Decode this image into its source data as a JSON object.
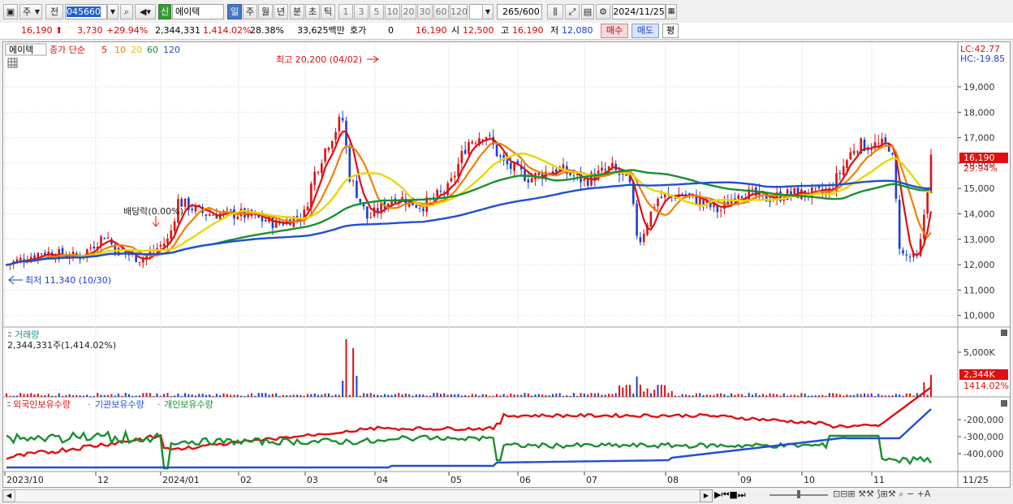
{
  "toolbar": {
    "market": "주",
    "market2": "전",
    "code": "045660",
    "name": "에이텍",
    "badge": "신",
    "periods": [
      "일",
      "주",
      "월",
      "년",
      "분",
      "초",
      "틱"
    ],
    "active_period": "일",
    "minutes": [
      "1",
      "3",
      "5",
      "10",
      "20",
      "30",
      "60",
      "120"
    ],
    "count": "265",
    "count_total": "/600",
    "date": "2024/11/25"
  },
  "pricebar": {
    "price": "16,190",
    "change": "3,730",
    "change_pct": "+29.94%",
    "volume": "2,344,331",
    "volume_pct": "1,414.02%",
    "turnover": "28.38%",
    "amount": "33,625백만",
    "hoga_label": "호가",
    "hoga_value": "0",
    "current": "16,190",
    "open_label": "시",
    "open": "12,500",
    "high_label": "고",
    "high": "16,190",
    "low_label": "저",
    "low": "12,080",
    "buy_button": "매수",
    "sell_button": "매도",
    "avg_button": "평"
  },
  "price_panel": {
    "stock_label": "에이텍",
    "legend_prefix": "종가 단순",
    "ma_labels": [
      "5",
      "10",
      "20",
      "60",
      "120"
    ],
    "ma_colors": [
      "#e01010",
      "#f08000",
      "#e8d800",
      "#189030",
      "#2050d0"
    ],
    "max_annotation": "최고 20,200 (04/02)",
    "min_annotation": "최저 11,340 (10/30)",
    "dividend_annotation": "배당락(0.00%)",
    "lc_label": "LC:42.77",
    "hc_label": "HC:-19.85",
    "y_ticks": [
      "19,000",
      "18,000",
      "17,000",
      "16,000",
      "15,000",
      "14,000",
      "13,000",
      "12,000",
      "11,000",
      "10,000"
    ],
    "current_price_tag": "16,190",
    "current_pct_tag": "29.94%"
  },
  "volume_panel": {
    "title": "거래량",
    "subtitle": "2,344,331주(1,414.02%)",
    "y_tick": "5,000K",
    "tag": "2,344K",
    "tag_pct": "1414.02%"
  },
  "holding_panel": {
    "legend": [
      "외국인보유수량",
      "기관보유수량",
      "개인보유수량"
    ],
    "legend_colors": [
      "#e01010",
      "#189030",
      "#2050d0"
    ],
    "y_ticks": [
      "-200,000",
      "-300,000",
      "-400,000"
    ]
  },
  "x_axis": {
    "labels": [
      "2023/10",
      "12",
      "2024/01",
      "02",
      "03",
      "04",
      "05",
      "06",
      "07",
      "08",
      "09",
      "10",
      "11",
      "11/25"
    ]
  },
  "colors": {
    "up": "#e01010",
    "down": "#1a3fd0",
    "grid": "#d8d8d8"
  }
}
